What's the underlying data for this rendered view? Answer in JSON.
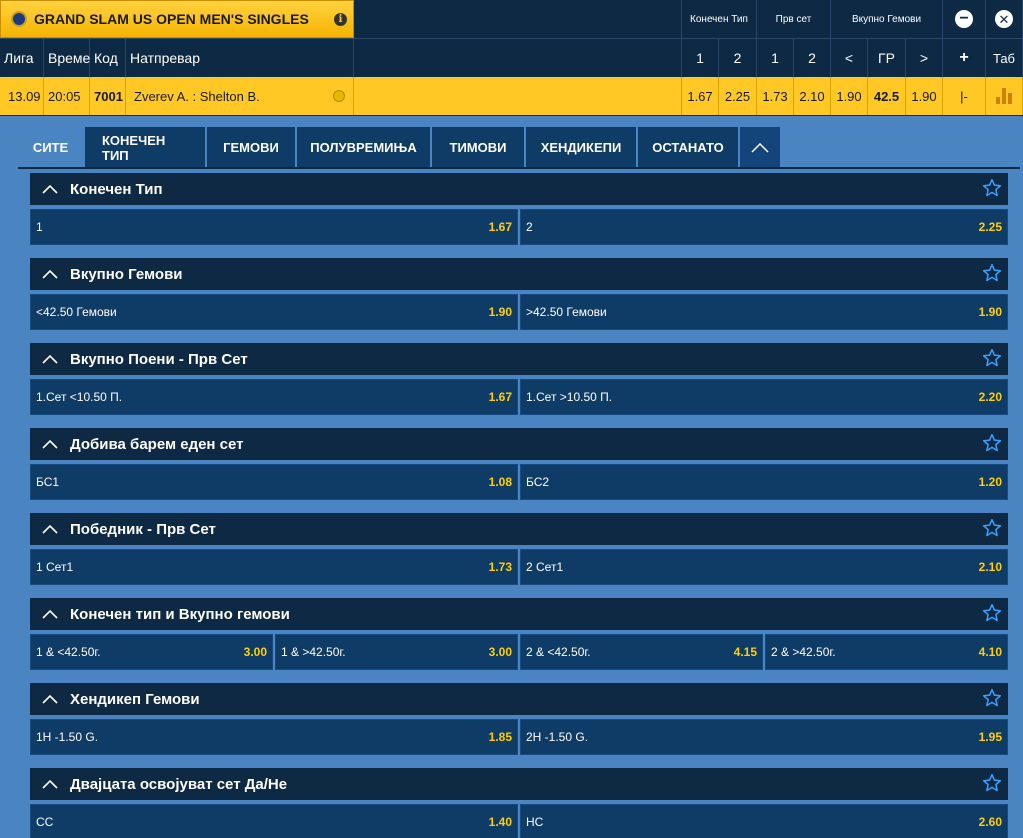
{
  "league": {
    "title": "GRAND SLAM US OPEN MEN'S SINGLES",
    "info_icon": "info-icon"
  },
  "header": {
    "group_final": "Конечен Тип",
    "group_first_set": "Прв сет",
    "group_total_games": "Вкупно Гемови",
    "col_league": "Лига",
    "col_time": "Време",
    "col_code": "Код",
    "col_match": "Натпревар",
    "col_1": "1",
    "col_2": "2",
    "col_s1": "1",
    "col_s2": "2",
    "col_lt": "<",
    "col_gr": "ГР",
    "col_gt": ">",
    "col_plus": "+",
    "col_tab": "Таб"
  },
  "event": {
    "date": "13.09",
    "time": "20:05",
    "code": "7001",
    "match": "Zverev A. : Shelton B.",
    "odd_1": "1.67",
    "odd_2": "2.25",
    "set_1": "1.73",
    "set_2": "2.10",
    "under": "1.90",
    "line": "42.5",
    "over": "1.90",
    "more": "|-"
  },
  "tabs": [
    "СИТЕ",
    "КОНЕЧЕН ТИП",
    "ГЕМОВИ",
    "ПОЛУВРЕМИЊА",
    "ТИМОВИ",
    "ХЕНДИКЕПИ",
    "ОСТАНАТО"
  ],
  "markets": [
    {
      "title": "Конечен Тип",
      "selections": [
        {
          "label": "1",
          "odd": "1.67"
        },
        {
          "label": "2",
          "odd": "2.25"
        }
      ]
    },
    {
      "title": "Вкупно Гемови",
      "selections": [
        {
          "label": "<42.50 Гемови",
          "odd": "1.90"
        },
        {
          "label": ">42.50 Гемови",
          "odd": "1.90"
        }
      ]
    },
    {
      "title": "Вкупно Поени - Прв Сет",
      "selections": [
        {
          "label": "1.Сет <10.50 П.",
          "odd": "1.67"
        },
        {
          "label": "1.Сет >10.50 П.",
          "odd": "2.20"
        }
      ]
    },
    {
      "title": "Добива барем еден сет",
      "selections": [
        {
          "label": "БС1",
          "odd": "1.08"
        },
        {
          "label": "БС2",
          "odd": "1.20"
        }
      ]
    },
    {
      "title": "Победник - Прв Сет",
      "selections": [
        {
          "label": "1 Сет1",
          "odd": "1.73"
        },
        {
          "label": "2 Сет1",
          "odd": "2.10"
        }
      ]
    },
    {
      "title": "Конечен тип и Вкупно гемови",
      "selections": [
        {
          "label": "1 & <42.50г.",
          "odd": "3.00"
        },
        {
          "label": "1 & >42.50г.",
          "odd": "3.00"
        },
        {
          "label": "2 & <42.50г.",
          "odd": "4.15"
        },
        {
          "label": "2 & >42.50г.",
          "odd": "4.10"
        }
      ]
    },
    {
      "title": "Хендикеп Гемови",
      "selections": [
        {
          "label": "1H -1.50 G.",
          "odd": "1.85"
        },
        {
          "label": "2H -1.50 G.",
          "odd": "1.95"
        }
      ]
    },
    {
      "title": "Двајцата освојуват сет Да/Не",
      "selections": [
        {
          "label": "СС",
          "odd": "1.40"
        },
        {
          "label": "НС",
          "odd": "2.60"
        }
      ]
    }
  ],
  "colors": {
    "accent": "#ffc825",
    "odd": "#ffd000",
    "panel": "#0f3b67",
    "header": "#0e2944",
    "background": "#4a85c1"
  }
}
